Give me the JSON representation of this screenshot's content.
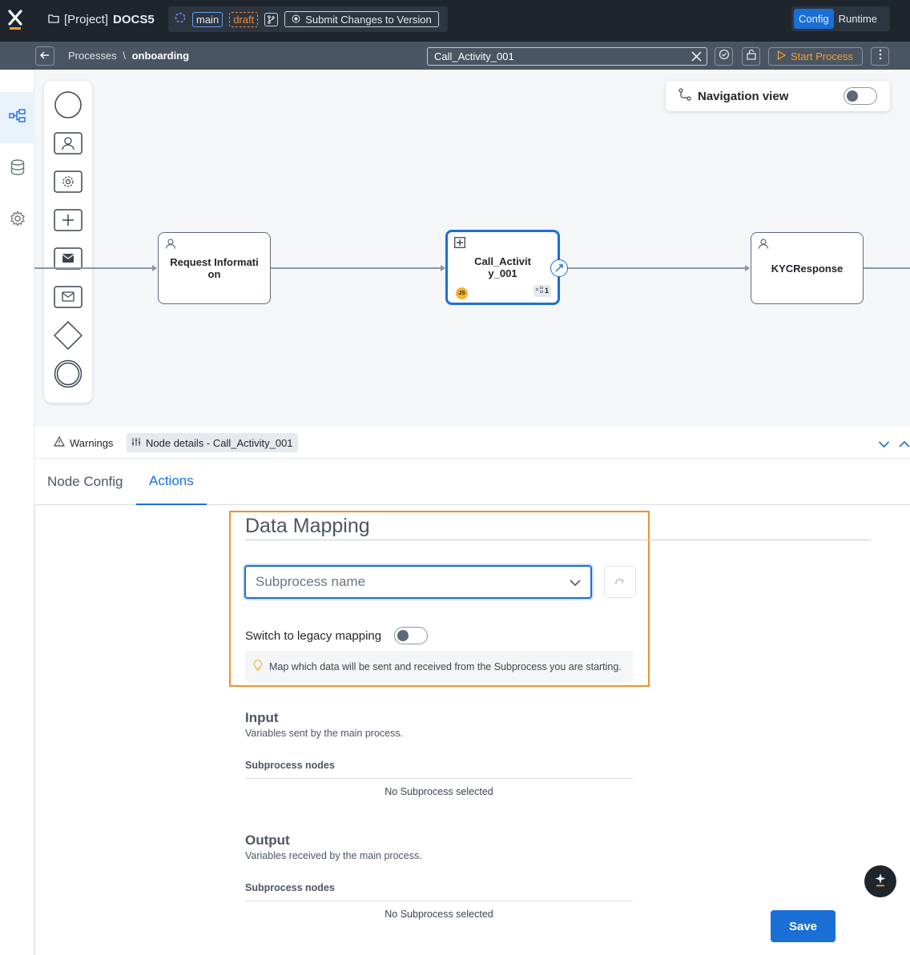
{
  "header": {
    "project_prefix": "[Project]",
    "project_name": "DOCS5",
    "branch": "main",
    "status": "draft",
    "submit_label": "Submit Changes to Version",
    "modes": [
      "Config",
      "Runtime"
    ],
    "active_mode": "Config"
  },
  "subbar": {
    "breadcrumb_root": "Processes",
    "separator": "\\",
    "breadcrumb_current": "onboarding",
    "search_value": "Call_Activity_001",
    "start_label": "Start Process"
  },
  "left_nav": [
    "process-diagram-icon",
    "database-icon",
    "gear-icon"
  ],
  "palette": [
    "start-event-icon",
    "user-task-icon",
    "service-task-icon",
    "subprocess-icon",
    "send-message-icon",
    "receive-message-icon",
    "gateway-icon",
    "end-event-icon"
  ],
  "navigation_view": {
    "label": "Navigation view",
    "enabled": false
  },
  "nodes": [
    {
      "label": "Request Informati\non"
    },
    {
      "label": "Call_Activit\ny_001",
      "badge_js": "JS",
      "badge_count": "1"
    },
    {
      "label": "KYCResponse"
    }
  ],
  "panel_bar": {
    "warnings_label": "Warnings",
    "details_label": "Node details - Call_Activity_001"
  },
  "tabs": [
    "Node Config",
    "Actions"
  ],
  "active_tab": "Actions",
  "data_mapping": {
    "title": "Data Mapping",
    "select_placeholder": "Subprocess name",
    "legacy_label": "Switch to legacy mapping",
    "legacy_enabled": false,
    "hint": "Map which data will be sent and received from the Subprocess you are starting."
  },
  "input": {
    "title": "Input",
    "subtitle": "Variables sent by the main process.",
    "column": "Subprocess nodes",
    "empty": "No Subprocess selected"
  },
  "output": {
    "title": "Output",
    "subtitle": "Variables received by the main process.",
    "column": "Subprocess nodes",
    "empty": "No Subprocess selected"
  },
  "save_label": "Save",
  "colors": {
    "accent": "#1a6fd6",
    "warning": "#f0902a",
    "topbar": "#1f252d"
  }
}
